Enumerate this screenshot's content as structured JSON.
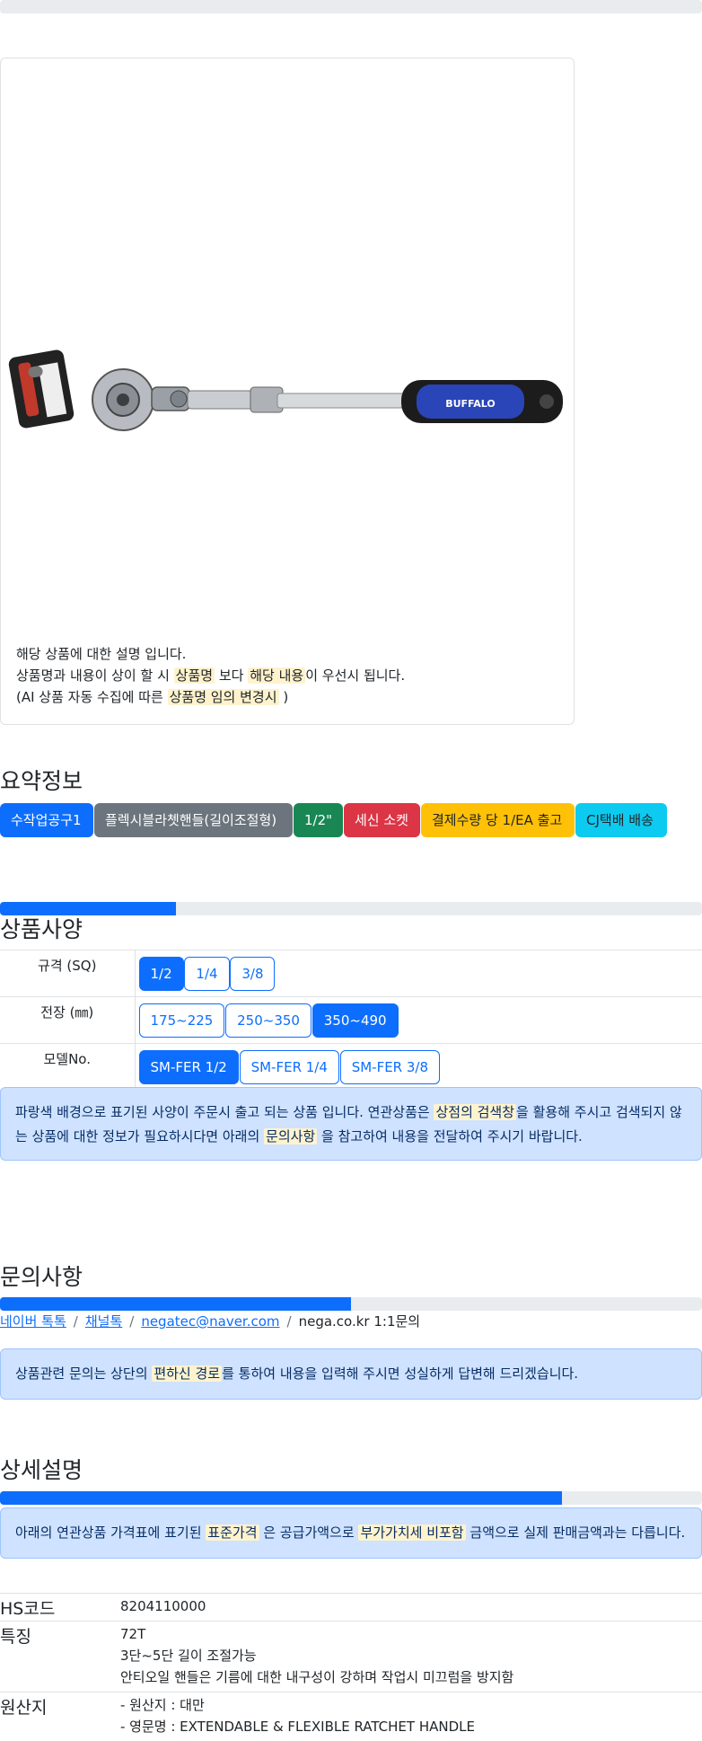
{
  "product": {
    "image_alt": "플렉시블라쳇핸들 BUFFALO",
    "brand_text": "BUFFALO",
    "notice": {
      "line1": "해당 상품에 대한 설명 입니다.",
      "line2_a": "상품명과 내용이 상이 할 시",
      "line2_hl1": "상품명",
      "line2_b": "보다",
      "line2_hl2": "해당 내용",
      "line2_c": "이 우선시 됩니다.",
      "line3_a": "(AI 상품 자동 수집에 따른",
      "line3_hl": "상품명 임의 변경시",
      "line3_b": ")"
    }
  },
  "summary": {
    "title": "요약정보",
    "badges": [
      "수작업공구1",
      "플렉시블라쳇핸들(길이조절형)",
      "1/2\"",
      "세신 소켓",
      "결제수량 당 1/EA 출고",
      "CJ택배 배송"
    ]
  },
  "specs": {
    "title": "상품사양",
    "progress": 0.25,
    "rows": [
      {
        "label": "규격 (SQ)",
        "options": [
          "1/2",
          "1/4",
          "3/8"
        ],
        "selected": 0
      },
      {
        "label": "전장 (㎜)",
        "options": [
          "175~225",
          "250~350",
          "350~490"
        ],
        "selected": 2
      },
      {
        "label": "모델No.",
        "options": [
          "SM-FER 1/2",
          "SM-FER 1/4",
          "SM-FER 3/8"
        ],
        "selected": 0
      }
    ],
    "note": {
      "a": "파랑색 배경으로 표기된 사양이 주문시 출고 되는 상품 입니다. 연관상품은",
      "hl1": "상점의 검색창",
      "b": "을 활용해 주시고 검색되지 않는 상품에 대한 정보가 필요하시다면 아래의",
      "hl2": "문의사항",
      "c": "을 참고하여 내용을 전달하여 주시기 바랍니다."
    }
  },
  "inquiry": {
    "title": "문의사항",
    "progress": 0.5,
    "links": [
      "네이버 톡톡",
      "채널톡",
      "negatec@naver.com"
    ],
    "last": "nega.co.kr 1:1문의",
    "note": {
      "a": "상품관련 문의는 상단의",
      "hl": "편하신 경로",
      "b": "를 통하여 내용을 입력해 주시면 성실하게 답변해 드리겠습니다."
    }
  },
  "detail": {
    "title": "상세설명",
    "progress": 0.8,
    "note": {
      "a": "아래의 연관상품 가격표에 표기된",
      "hl1": "표준가격",
      "b": "은 공급가액으로",
      "hl2": "부가가치세 비포함",
      "c": "금액으로 실제 판매금액과는 다릅니다."
    },
    "rows": [
      {
        "label": "HS코드",
        "lines": [
          "8204110000"
        ]
      },
      {
        "label": "특징",
        "lines": [
          "72T",
          "3단~5단 길이 조절가능",
          "안티오일 핸들은 기름에 대한 내구성이 강하며 작업시 미끄럼을 방지함"
        ]
      },
      {
        "label": "원산지",
        "lines": [
          "- 원산지 : 대만",
          "- 영문명 : EXTENDABLE & FLEXIBLE RATCHET HANDLE"
        ]
      }
    ]
  }
}
